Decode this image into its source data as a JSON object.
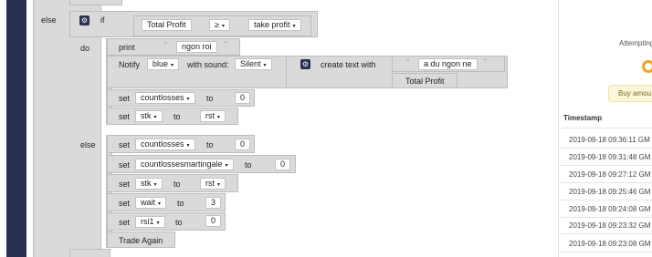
{
  "blocks": {
    "else_top": "else",
    "if": "if",
    "do": "do",
    "else_inner": "else",
    "total_profit": "Total Profit",
    "operator": "≥",
    "take_profit": "take profit",
    "print": "print",
    "print_text": "ngon roi",
    "notify": "Notify",
    "notify_color": "blue",
    "with_sound": "with sound:",
    "sound": "Silent",
    "create_text_with": "create text with",
    "text_item": "a du ngon ne",
    "text_total_profit": "Total Profit",
    "set": "set",
    "to": "to",
    "countlosses": "countlosses",
    "countlossesmartingale": "countlossesmartingale",
    "stk": "stk",
    "rst": "rst",
    "wait": "wait",
    "rsi1": "rsi1",
    "zero": "0",
    "three": "3",
    "trade_again": "Trade Again"
  },
  "side": {
    "attempting": "Attempting",
    "buy": "Buy amou",
    "timestamp_header": "Timestamp",
    "timestamps": [
      "2019-09-18 09:36:11 GM",
      "2019-09-18 09:31:48 GM",
      "2019-09-18 09:27:12 GM",
      "2019-09-18 09:25:46 GM",
      "2019-09-18 09:24:08 GM",
      "2019-09-18 09:23:32 GM",
      "2019-09-18 09:23:08 GM"
    ]
  },
  "colors": {
    "sidebar": "#2a3050",
    "block": "#dadada",
    "spinner": "#f3a21b",
    "notice": "#fbf5da"
  }
}
